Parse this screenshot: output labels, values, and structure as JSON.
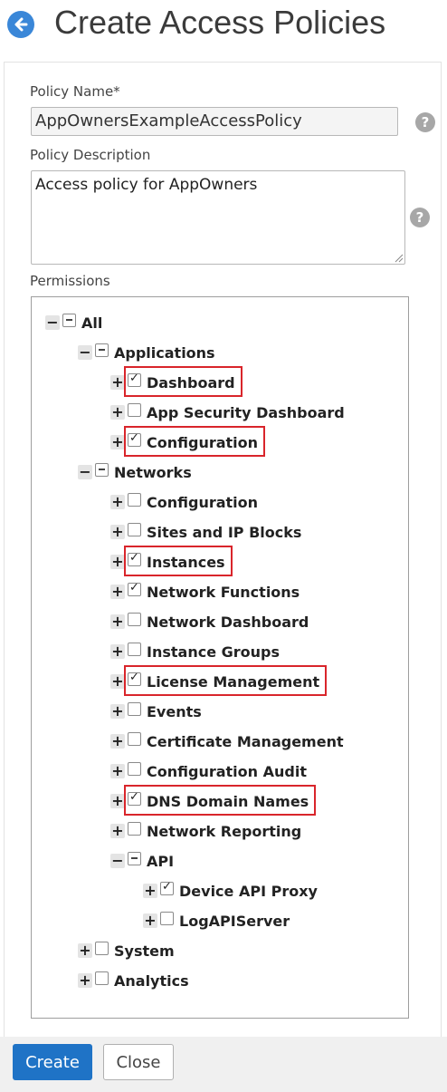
{
  "page": {
    "title": "Create Access Policies",
    "back_icon": "arrow-left-icon",
    "accent_color": "#3a87d8"
  },
  "form": {
    "policy_name_label": "Policy Name*",
    "policy_name_value": "AppOwnersExampleAccessPolicy",
    "policy_description_label": "Policy Description",
    "policy_description_value": "Access policy for AppOwners",
    "permissions_label": "Permissions",
    "help_icon": "?"
  },
  "tree": [
    {
      "label": "All",
      "toggle": "minus",
      "state": "partial",
      "level": 0,
      "highlighted": false
    },
    {
      "label": "Applications",
      "toggle": "minus",
      "state": "partial",
      "level": 1,
      "highlighted": false
    },
    {
      "label": "Dashboard",
      "toggle": "plus",
      "state": "checked",
      "level": 2,
      "highlighted": true
    },
    {
      "label": "App Security Dashboard",
      "toggle": "plus",
      "state": "unchecked",
      "level": 2,
      "highlighted": false
    },
    {
      "label": "Configuration",
      "toggle": "plus",
      "state": "checked",
      "level": 2,
      "highlighted": true
    },
    {
      "label": "Networks",
      "toggle": "minus",
      "state": "partial",
      "level": 1,
      "highlighted": false
    },
    {
      "label": "Configuration",
      "toggle": "plus",
      "state": "unchecked",
      "level": 2,
      "highlighted": false
    },
    {
      "label": "Sites and IP Blocks",
      "toggle": "plus",
      "state": "unchecked",
      "level": 2,
      "highlighted": false
    },
    {
      "label": "Instances",
      "toggle": "plus",
      "state": "checked",
      "level": 2,
      "highlighted": true
    },
    {
      "label": "Network Functions",
      "toggle": "plus",
      "state": "checked",
      "level": 2,
      "highlighted": false
    },
    {
      "label": "Network Dashboard",
      "toggle": "plus",
      "state": "unchecked",
      "level": 2,
      "highlighted": false
    },
    {
      "label": "Instance Groups",
      "toggle": "plus",
      "state": "unchecked",
      "level": 2,
      "highlighted": false
    },
    {
      "label": "License Management",
      "toggle": "plus",
      "state": "checked",
      "level": 2,
      "highlighted": true
    },
    {
      "label": "Events",
      "toggle": "plus",
      "state": "unchecked",
      "level": 2,
      "highlighted": false
    },
    {
      "label": "Certificate Management",
      "toggle": "plus",
      "state": "unchecked",
      "level": 2,
      "highlighted": false
    },
    {
      "label": "Configuration Audit",
      "toggle": "plus",
      "state": "unchecked",
      "level": 2,
      "highlighted": false
    },
    {
      "label": "DNS Domain Names",
      "toggle": "plus",
      "state": "checked",
      "level": 2,
      "highlighted": true
    },
    {
      "label": "Network Reporting",
      "toggle": "plus",
      "state": "unchecked",
      "level": 2,
      "highlighted": false
    },
    {
      "label": "API",
      "toggle": "minus",
      "state": "partial",
      "level": 2,
      "highlighted": false
    },
    {
      "label": "Device API Proxy",
      "toggle": "plus",
      "state": "checked",
      "level": 3,
      "highlighted": false
    },
    {
      "label": "LogAPIServer",
      "toggle": "plus",
      "state": "unchecked",
      "level": 3,
      "highlighted": false
    },
    {
      "label": "System",
      "toggle": "plus",
      "state": "unchecked",
      "level": 1,
      "highlighted": false
    },
    {
      "label": "Analytics",
      "toggle": "plus",
      "state": "unchecked",
      "level": 1,
      "highlighted": false
    }
  ],
  "highlight_color": "#d9252b",
  "footer": {
    "create_label": "Create",
    "close_label": "Close",
    "primary_color": "#1f73c6"
  }
}
